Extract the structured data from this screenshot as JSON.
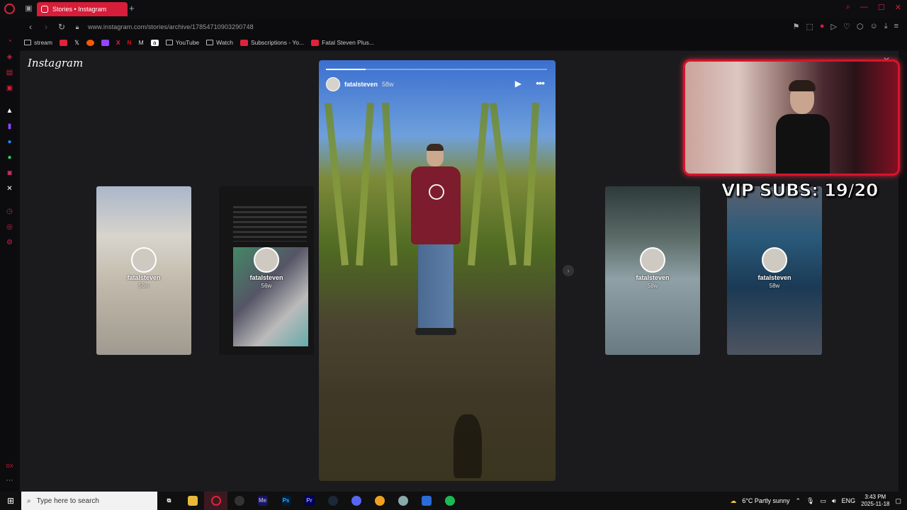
{
  "browser": {
    "tab_title": "Stories • Instagram",
    "url": "www.instagram.com/stories/archive/17854710903290748"
  },
  "bookmarks": [
    {
      "label": "stream",
      "icon": "folder-icon"
    },
    {
      "label": "",
      "icon": "youtube-icon"
    },
    {
      "label": "",
      "icon": "x-icon"
    },
    {
      "label": "",
      "icon": "reddit-icon"
    },
    {
      "label": "",
      "icon": "twitch-icon"
    },
    {
      "label": "",
      "icon": "x-red-icon"
    },
    {
      "label": "",
      "icon": "netflix-icon"
    },
    {
      "label": "",
      "icon": "gmail-icon"
    },
    {
      "label": "",
      "icon": "amazon-icon"
    },
    {
      "label": "YouTube",
      "icon": "folder-icon"
    },
    {
      "label": "Watch",
      "icon": "folder-icon"
    },
    {
      "label": "Subscriptions - Yo...",
      "icon": "youtube-icon"
    },
    {
      "label": "Fatal Steven Plus...",
      "icon": "youtube-icon"
    }
  ],
  "instagram": {
    "logo_text": "Instagram",
    "story": {
      "username": "fatalsteven",
      "time": "58w",
      "progress": 0.18
    },
    "side_stories": [
      {
        "username": "fatalsteven",
        "time": "56w"
      },
      {
        "username": "fatalsteven",
        "time": "56w"
      },
      {
        "username": "fatalsteven",
        "time": "58w"
      },
      {
        "username": "fatalsteven",
        "time": "58w"
      }
    ]
  },
  "overlay": {
    "vip_text": "VIP SUBS: 19/20"
  },
  "taskbar": {
    "search_placeholder": "Type here to search",
    "weather": "6°C  Partly sunny",
    "lang": "ENG",
    "time": "3:43 PM",
    "date": "2025-11-18"
  },
  "colors": {
    "accent": "#d61d39",
    "background": "#1b1b1e"
  }
}
